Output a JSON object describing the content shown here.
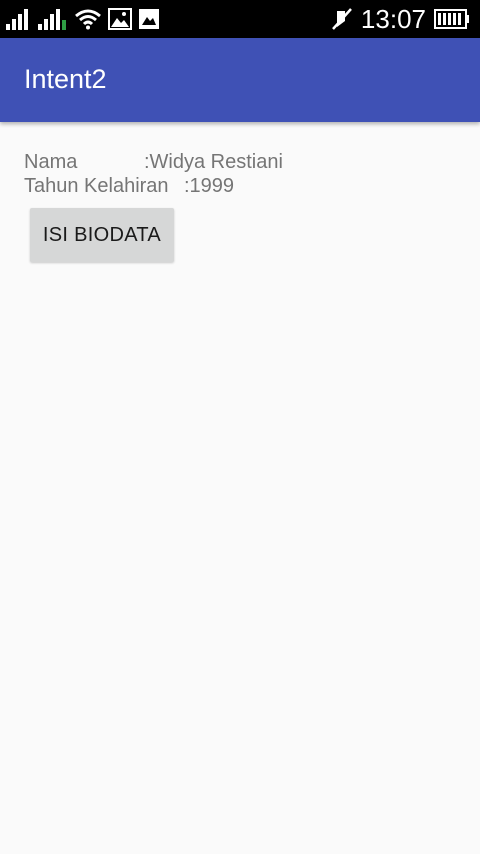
{
  "status_bar": {
    "time": "13:07",
    "icons": [
      "signal-icon",
      "signal-icon",
      "wifi-icon",
      "image-icon",
      "gallery-icon",
      "silent-icon",
      "battery-icon"
    ]
  },
  "app_bar": {
    "title": "Intent2",
    "color": "#3f51b5"
  },
  "biodata": {
    "nama_label": "Nama",
    "nama_value": ":Widya Restiani",
    "tahun_label": "Tahun Kelahiran",
    "tahun_value": ":1999"
  },
  "button": {
    "label": "ISI BIODATA"
  }
}
